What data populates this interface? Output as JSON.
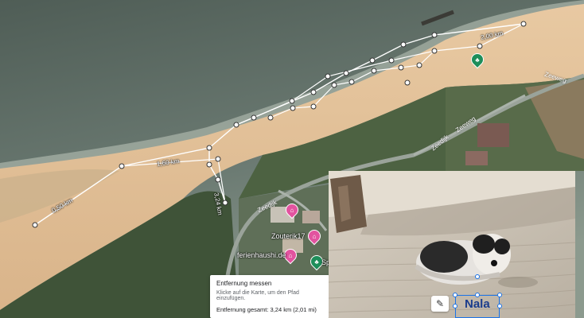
{
  "measure": {
    "segments": [
      "0,50 km",
      "1,60 km",
      "2,00 km",
      "3,24 km"
    ]
  },
  "roads": [
    "Zeeweg",
    "Zeeweg",
    "Zeedijk",
    "Zeedijk"
  ],
  "places": {
    "zouterik": "Zouterik17",
    "ferienhaus": "ferienhaushi.de",
    "sp": "Sp"
  },
  "info_panel": {
    "title": "Entfernung messen",
    "subtitle": "Klicke auf die Karte, um den Pfad einzufügen.",
    "total": "Entfernung gesamt: 3,24 km (2,01 mi)"
  },
  "photo": {
    "caption": "Nala"
  },
  "icons": {
    "pin_pink": "map-pin-icon",
    "pin_green": "park-pin-icon",
    "edit": "pencil-edit-icon"
  }
}
